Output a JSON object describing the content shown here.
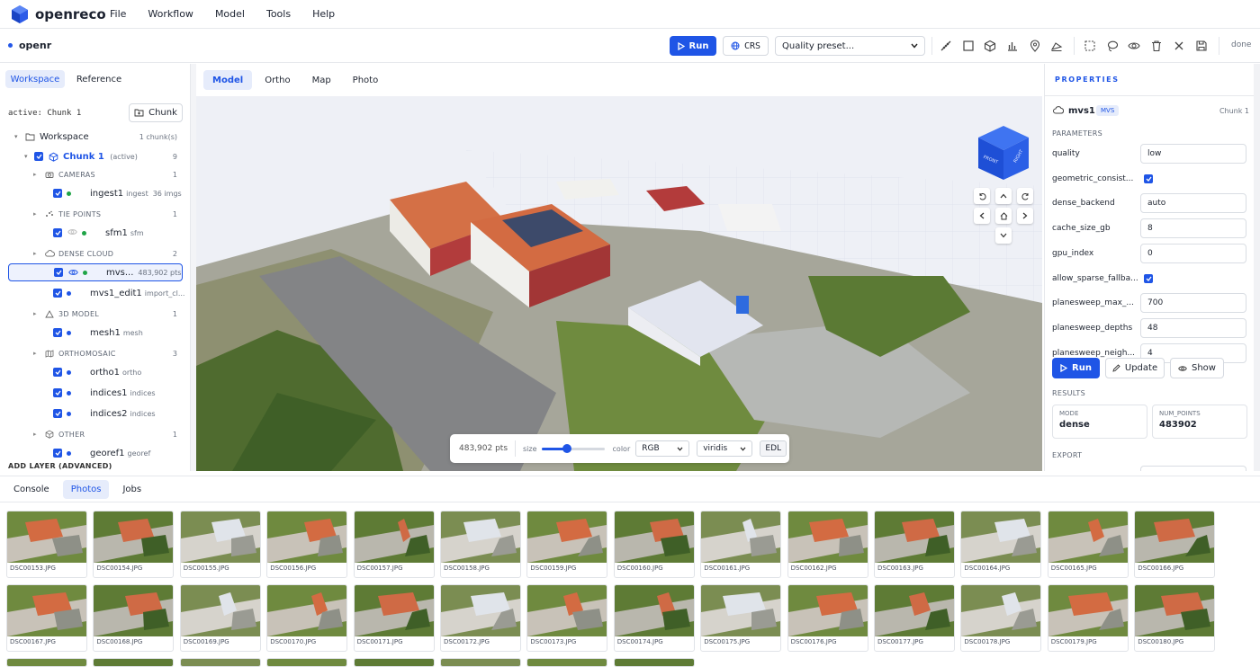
{
  "app": {
    "name": "openreco",
    "menus": [
      "File",
      "Workflow",
      "Model",
      "Tools",
      "Help"
    ]
  },
  "toolbar": {
    "project": "openr",
    "run_label": "Run",
    "crs_label": "CRS",
    "preset_placeholder": "Quality preset...",
    "status": "done",
    "icons": [
      "ruler-icon",
      "square-icon",
      "cube-icon",
      "bar-chart-icon",
      "pin-icon",
      "area-icon",
      "select-icon",
      "lasso-icon",
      "eye-icon",
      "trash-icon",
      "close-icon",
      "save-icon"
    ]
  },
  "left": {
    "tabs": [
      "Workspace",
      "Reference"
    ],
    "active_text": "active: Chunk 1",
    "chunk_button": "Chunk",
    "workspace": {
      "label": "Workspace",
      "count": "1 chunk(s)"
    },
    "chunk": {
      "label": "Chunk 1",
      "tag": "(active)",
      "count": "9"
    },
    "groups": [
      {
        "label": "CAMERAS",
        "count": "1",
        "items": [
          {
            "name": "ingest1",
            "sub": "ingest",
            "extra": "36 imgs",
            "dot": "green"
          }
        ]
      },
      {
        "label": "TIE POINTS",
        "count": "1",
        "items": [
          {
            "name": "sfm1",
            "sub": "sfm",
            "extra": "",
            "dot": "green"
          }
        ]
      },
      {
        "label": "DENSE CLOUD",
        "count": "2",
        "items": [
          {
            "name": "mvs...",
            "sub": "",
            "extra": "483,902 pts",
            "dot": "green"
          },
          {
            "name": "mvs1_edit1",
            "sub": "import_cl...",
            "extra": "",
            "dot": "blue"
          }
        ]
      },
      {
        "label": "3D MODEL",
        "count": "1",
        "items": [
          {
            "name": "mesh1",
            "sub": "mesh",
            "extra": "",
            "dot": "blue"
          }
        ]
      },
      {
        "label": "ORTHOMOSAIC",
        "count": "3",
        "items": [
          {
            "name": "ortho1",
            "sub": "ortho",
            "extra": "",
            "dot": "blue"
          },
          {
            "name": "indices1",
            "sub": "indices",
            "extra": "",
            "dot": "blue"
          },
          {
            "name": "indices2",
            "sub": "indices",
            "extra": "",
            "dot": "blue"
          }
        ]
      },
      {
        "label": "OTHER",
        "count": "1",
        "items": [
          {
            "name": "georef1",
            "sub": "georef",
            "extra": "",
            "dot": "blue"
          }
        ]
      }
    ],
    "add_layer": "ADD LAYER (ADVANCED)"
  },
  "viewer": {
    "tabs": [
      "Model",
      "Ortho",
      "Map",
      "Photo"
    ],
    "cube_front": "FRONT",
    "cube_right": "RIGHT",
    "points": "483,902 pts",
    "size_label": "size",
    "size_value": 0.4,
    "color_label": "color",
    "color_mode": "RGB",
    "colormap": "viridis",
    "edl_label": "EDL"
  },
  "properties": {
    "title": "PROPERTIES",
    "node": "mvs1",
    "badge": "MVS",
    "chunk": "Chunk 1",
    "params_title": "PARAMETERS",
    "params": [
      {
        "key": "quality",
        "value": "low",
        "type": "input"
      },
      {
        "key": "geometric_consist...",
        "value": "",
        "type": "check"
      },
      {
        "key": "dense_backend",
        "value": "auto",
        "type": "input"
      },
      {
        "key": "cache_size_gb",
        "value": "8",
        "type": "input"
      },
      {
        "key": "gpu_index",
        "value": "0",
        "type": "input"
      },
      {
        "key": "allow_sparse_fallba...",
        "value": "",
        "type": "check"
      },
      {
        "key": "planesweep_max_...",
        "value": "700",
        "type": "input"
      },
      {
        "key": "planesweep_depths",
        "value": "48",
        "type": "input"
      },
      {
        "key": "planesweep_neigh...",
        "value": "4",
        "type": "input"
      }
    ],
    "run_label": "Run",
    "update_label": "Update",
    "show_label": "Show",
    "results_title": "RESULTS",
    "mode_key": "MODE",
    "mode_value": "dense",
    "num_key": "NUM_POINTS",
    "num_value": "483902",
    "export_title": "EXPORT"
  },
  "bottom": {
    "tabs": [
      "Console",
      "Photos",
      "Jobs"
    ],
    "photos": [
      "DSC00153.JPG",
      "DSC00154.JPG",
      "DSC00155.JPG",
      "DSC00156.JPG",
      "DSC00157.JPG",
      "DSC00158.JPG",
      "DSC00159.JPG",
      "DSC00160.JPG",
      "DSC00161.JPG",
      "DSC00162.JPG",
      "DSC00163.JPG",
      "DSC00164.JPG",
      "DSC00165.JPG",
      "DSC00166.JPG",
      "DSC00167.JPG",
      "DSC00168.JPG",
      "DSC00169.JPG",
      "DSC00170.JPG",
      "DSC00171.JPG",
      "DSC00172.JPG",
      "DSC00173.JPG",
      "DSC00174.JPG",
      "DSC00175.JPG",
      "DSC00176.JPG",
      "DSC00177.JPG",
      "DSC00178.JPG",
      "DSC00179.JPG",
      "DSC00180.JPG"
    ]
  }
}
